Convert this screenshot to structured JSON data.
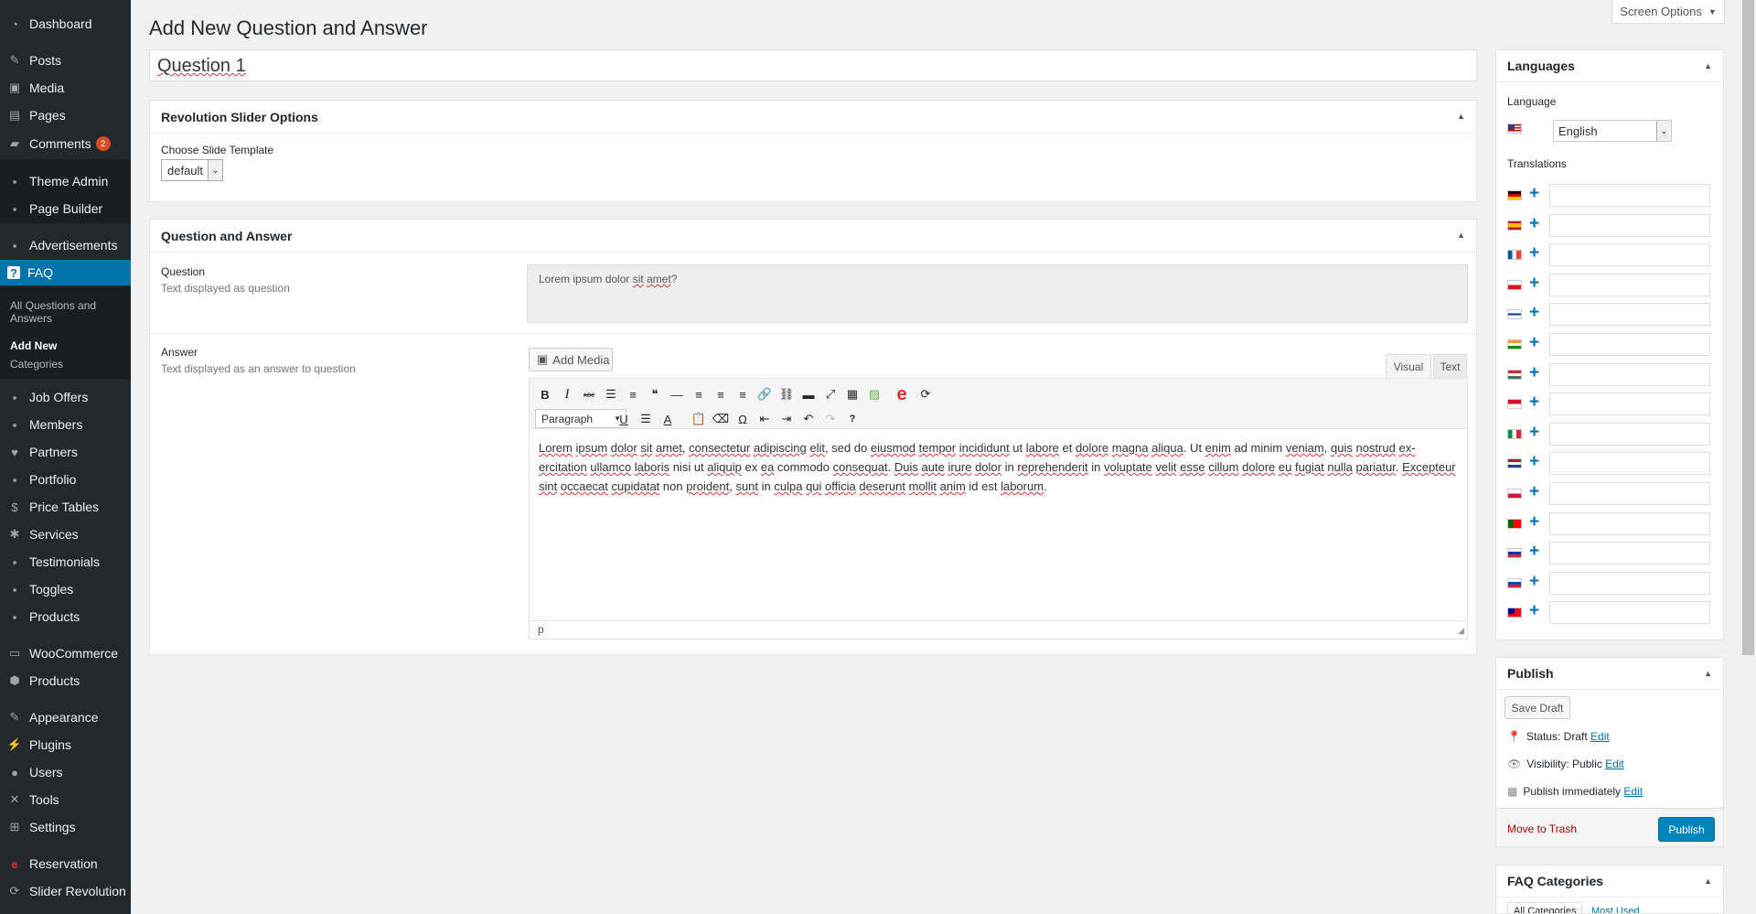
{
  "sidebar": {
    "items": [
      {
        "label": "Dashboard",
        "icon": "dashboard-icon",
        "glyph": "◔"
      },
      {
        "label": "Posts",
        "icon": "pin-icon",
        "glyph": "✎"
      },
      {
        "label": "Media",
        "icon": "media-icon",
        "glyph": "▣"
      },
      {
        "label": "Pages",
        "icon": "pages-icon",
        "glyph": "▤"
      },
      {
        "label": "Comments",
        "icon": "comment-icon",
        "glyph": "▰",
        "badge": "2"
      },
      {
        "label": "Theme Admin",
        "icon": "theme-admin-icon",
        "glyph": "▪"
      },
      {
        "label": "Page Builder",
        "icon": "page-builder-icon",
        "glyph": "▪"
      },
      {
        "label": "Advertisements",
        "icon": "advertisements-icon",
        "glyph": "▪"
      },
      {
        "label": "FAQ",
        "icon": "faq-icon",
        "glyph": "?"
      },
      {
        "label": "Job Offers",
        "icon": "job-offers-icon",
        "glyph": "▪"
      },
      {
        "label": "Members",
        "icon": "members-icon",
        "glyph": "▪"
      },
      {
        "label": "Partners",
        "icon": "partners-icon",
        "glyph": "♥"
      },
      {
        "label": "Portfolio",
        "icon": "portfolio-icon",
        "glyph": "▪"
      },
      {
        "label": "Price Tables",
        "icon": "price-tables-icon",
        "glyph": "$"
      },
      {
        "label": "Services",
        "icon": "services-icon",
        "glyph": "✱"
      },
      {
        "label": "Testimonials",
        "icon": "testimonials-icon",
        "glyph": "▪"
      },
      {
        "label": "Toggles",
        "icon": "toggles-icon",
        "glyph": "▪"
      },
      {
        "label": "Products",
        "icon": "products-icon",
        "glyph": "▪"
      },
      {
        "label": "WooCommerce",
        "icon": "woocommerce-icon",
        "glyph": "▭"
      },
      {
        "label": "Products",
        "icon": "archive-icon",
        "glyph": "⬢"
      },
      {
        "label": "Appearance",
        "icon": "appearance-icon",
        "glyph": "✎"
      },
      {
        "label": "Plugins",
        "icon": "plugins-icon",
        "glyph": "⚡"
      },
      {
        "label": "Users",
        "icon": "users-icon",
        "glyph": "●"
      },
      {
        "label": "Tools",
        "icon": "tools-icon",
        "glyph": "✕"
      },
      {
        "label": "Settings",
        "icon": "settings-icon",
        "glyph": "⊞"
      },
      {
        "label": "Reservation",
        "icon": "reservation-icon",
        "glyph": "e"
      },
      {
        "label": "Slider Revolution",
        "icon": "slider-revolution-icon",
        "glyph": "⟳"
      }
    ],
    "faq_submenu": [
      "All Questions and Answers",
      "Add New",
      "Categories"
    ]
  },
  "header": {
    "title": "Add New Question and Answer",
    "screen_options": "Screen Options"
  },
  "post_title": "Question 1",
  "revslider": {
    "title": "Revolution Slider Options",
    "template_label": "Choose Slide Template",
    "template_value": "default"
  },
  "qa": {
    "title": "Question and Answer",
    "question_label": "Question",
    "question_desc": "Text displayed as question",
    "question_value": "Lorem ipsum dolor sit amet?",
    "answer_label": "Answer",
    "answer_desc": "Text displayed as an answer to question",
    "add_media": "Add Media",
    "tab_visual": "Visual",
    "tab_text": "Text",
    "format": "Paragraph",
    "path": "p",
    "content": "Lorem ipsum dolor sit amet, consectetur adipiscing elit, sed do eiusmod tempor incididunt ut labore et dolore magna aliqua. Ut enim ad minim veniam, quis nostrud exercitation ullamco laboris nisi ut aliquip ex ea commodo consequat. Duis aute irure dolor in reprehenderit in voluptate velit esse cillum dolore eu fugiat nulla pariatur. Excepteur sint occaecat cupidatat non proident, sunt in culpa qui officia deserunt mollit anim id est laborum."
  },
  "languages": {
    "title": "Languages",
    "language_label": "Language",
    "language_value": "English",
    "translations_label": "Translations"
  },
  "publish": {
    "title": "Publish",
    "save_draft": "Save Draft",
    "status_label": "Status:",
    "status_value": "Draft",
    "visibility_label": "Visibility:",
    "visibility_value": "Public",
    "schedule_text": "Publish immediately",
    "edit": "Edit",
    "trash": "Move to Trash",
    "publish_button": "Publish"
  },
  "faq_categories": {
    "title": "FAQ Categories",
    "tab_all": "All Categories",
    "tab_most": "Most Used"
  },
  "colors": {
    "accent": "#0073aa",
    "sidebar": "#23282d",
    "trash": "#a00",
    "badge": "#d54e21"
  }
}
